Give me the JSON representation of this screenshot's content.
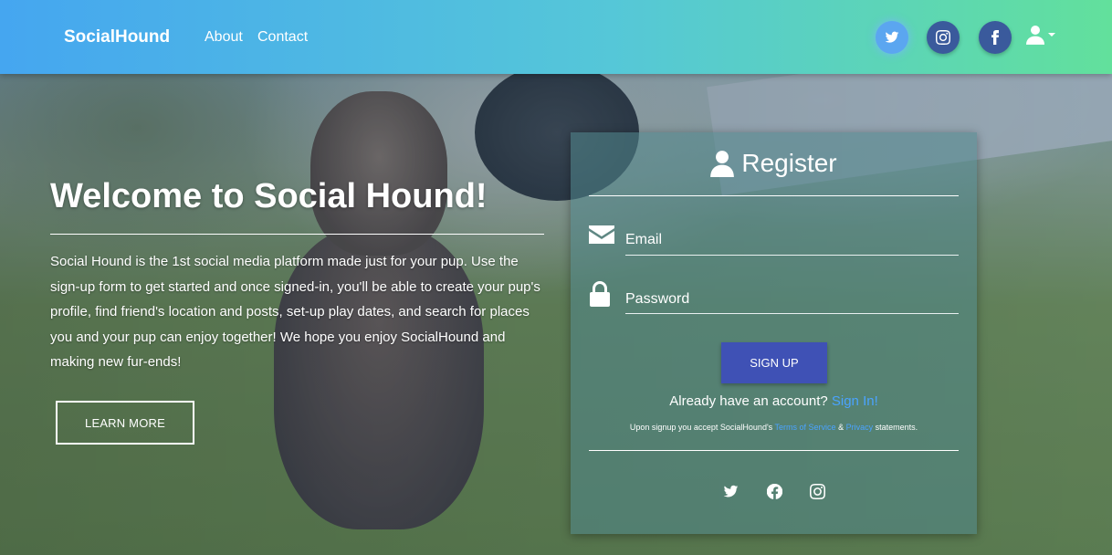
{
  "navbar": {
    "brand": "SocialHound",
    "links": [
      "About",
      "Contact"
    ],
    "social_icons": [
      "twitter-icon",
      "instagram-icon",
      "facebook-icon"
    ],
    "user_icon": "user-icon"
  },
  "hero": {
    "title": "Welcome to Social Hound!",
    "text": "Social Hound is the 1st social media platform made just for your pup. Use the sign-up form to get started and once signed-in, you'll be able to create your pup's profile, find friend's location and posts, set-up play dates, and search for places you and your pup can enjoy together! We hope you enjoy SocialHound and making new fur-ends!",
    "button": "LEARN MORE"
  },
  "register": {
    "title": "Register",
    "email_label": "Email",
    "password_label": "Password",
    "signup_button": "SIGN UP",
    "already_text": "Already have an account?",
    "signin_link": "Sign In!",
    "terms_prefix": "Upon signup you accept SocialHound's",
    "terms_link": "Terms of Service",
    "terms_amp": "&",
    "privacy_link": "Privacy",
    "terms_suffix": "statements.",
    "social_icons": [
      "twitter-icon",
      "facebook-icon",
      "instagram-icon"
    ]
  },
  "colors": {
    "nav_gradient_start": "#45a6f0",
    "nav_gradient_end": "#62e09c",
    "social_button": "#3a5a9c",
    "signup_button": "#3f51b5",
    "link": "#4aa3ff"
  }
}
